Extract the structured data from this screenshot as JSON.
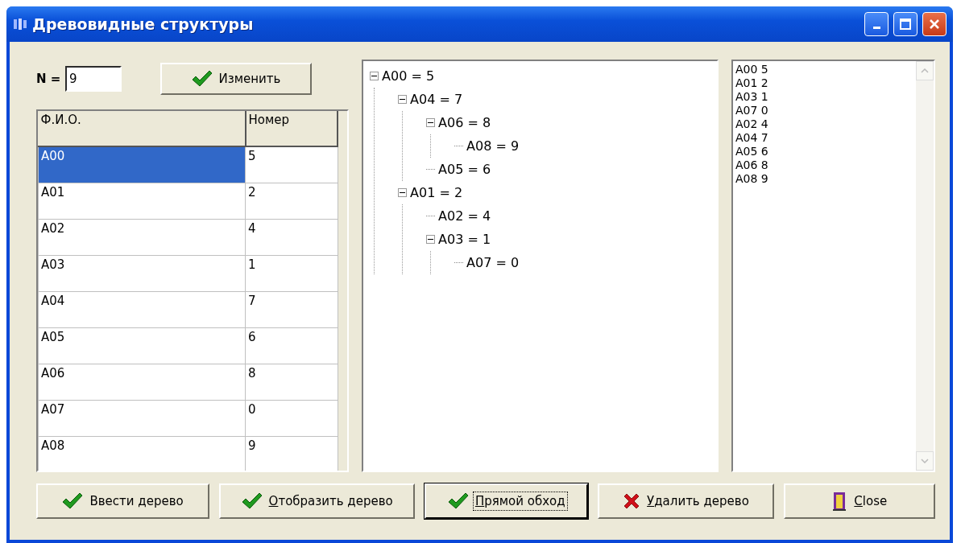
{
  "window": {
    "title": "Древовидные структуры"
  },
  "n_field": {
    "label": "N =",
    "value": "9"
  },
  "change_button": {
    "label": "Изменить"
  },
  "table": {
    "columns": [
      "Ф.И.О.",
      "Номер"
    ],
    "rows": [
      {
        "cells": [
          "A00",
          "5"
        ],
        "selected": true
      },
      {
        "cells": [
          "A01",
          "2"
        ],
        "selected": false
      },
      {
        "cells": [
          "A02",
          "4"
        ],
        "selected": false
      },
      {
        "cells": [
          "A03",
          "1"
        ],
        "selected": false
      },
      {
        "cells": [
          "A04",
          "7"
        ],
        "selected": false
      },
      {
        "cells": [
          "A05",
          "6"
        ],
        "selected": false
      },
      {
        "cells": [
          "A06",
          "8"
        ],
        "selected": false
      },
      {
        "cells": [
          "A07",
          "0"
        ],
        "selected": false
      },
      {
        "cells": [
          "A08",
          "9"
        ],
        "selected": false
      }
    ]
  },
  "tree": [
    {
      "label": "A00 = 5",
      "expanded": true,
      "children": [
        {
          "label": "A04 = 7",
          "expanded": true,
          "children": [
            {
              "label": "A06 = 8",
              "expanded": true,
              "children": [
                {
                  "label": "A08 = 9"
                }
              ]
            },
            {
              "label": "A05 = 6"
            }
          ]
        },
        {
          "label": "A01 = 2",
          "expanded": true,
          "children": [
            {
              "label": "A02 = 4"
            },
            {
              "label": "A03 = 1",
              "expanded": true,
              "children": [
                {
                  "label": "A07 = 0"
                }
              ]
            }
          ]
        }
      ]
    }
  ],
  "list": [
    "A00 5",
    "A01 2",
    "A03 1",
    "A07 0",
    "A02 4",
    "A04 7",
    "A05 6",
    "A06 8",
    "A08 9"
  ],
  "buttons": [
    {
      "label": "Ввести дерево",
      "kind": "check",
      "mnemonic": false,
      "focused": false
    },
    {
      "label": "Отобразить дерево",
      "kind": "check",
      "mnemonic": true,
      "focused": false
    },
    {
      "label": "Прямой обход",
      "kind": "check",
      "mnemonic": true,
      "focused": true
    },
    {
      "label": "Удалить дерево",
      "kind": "cross",
      "mnemonic": true,
      "focused": false
    },
    {
      "label": "Close",
      "kind": "door",
      "mnemonic": true,
      "focused": false
    }
  ]
}
